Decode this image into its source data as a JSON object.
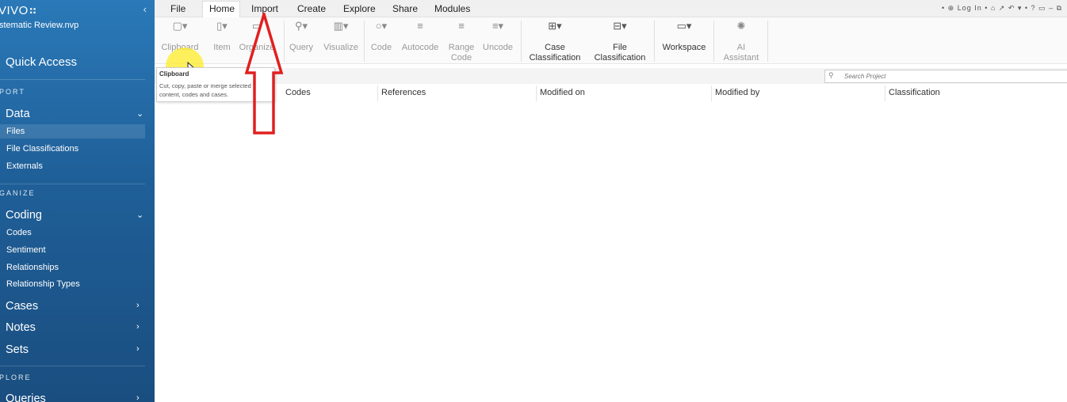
{
  "sidebar": {
    "brand": "VIVO",
    "brand_mark": "⠶",
    "collapse_icon": "‹",
    "project": "stematic Review.nvp",
    "quick_access": "Quick Access",
    "sections": {
      "import": "PORT",
      "organize": "GANIZE",
      "explore": "PLORE"
    },
    "data": {
      "label": "Data",
      "items": [
        "Files",
        "File Classifications",
        "Externals"
      ]
    },
    "coding": {
      "label": "Coding",
      "items": [
        "Codes",
        "Sentiment",
        "Relationships",
        "Relationship Types"
      ]
    },
    "cases": "Cases",
    "notes": "Notes",
    "sets": "Sets",
    "queries": "Queries",
    "chev_down": "⌄",
    "chev_right": "›"
  },
  "menu": {
    "items": [
      "File",
      "Home",
      "Import",
      "Create",
      "Explore",
      "Share",
      "Modules"
    ],
    "active": "Home",
    "topright": "• ⊕ Log In • ⌂ ↗ ↶ ▾ • ?   ▭   –   ⧉"
  },
  "ribbon": {
    "clipboard": "Clipboard",
    "item": "Item",
    "organize": "Organize",
    "query": "Query",
    "visualize": "Visualize",
    "code": "Code",
    "autocode": "Autocode",
    "range_code_1": "Range",
    "range_code_2": "Code",
    "uncode": "Uncode",
    "case_class_1": "Case",
    "case_class_2": "Classification",
    "file_class_1": "File",
    "file_class_2": "Classification",
    "workspace": "Workspace",
    "ai_1": "AI",
    "ai_2": "Assistant"
  },
  "tooltip": {
    "title": "Clipboard",
    "desc": "Cut, copy, paste or merge selected content, codes and cases."
  },
  "search": {
    "placeholder": "Search Project"
  },
  "columns": [
    "Codes",
    "References",
    "Modified on",
    "Modified by",
    "Classification"
  ],
  "colors": {
    "sidebar": "#1f5f98",
    "arrow": "#e02020",
    "highlight": "#ffec28"
  }
}
